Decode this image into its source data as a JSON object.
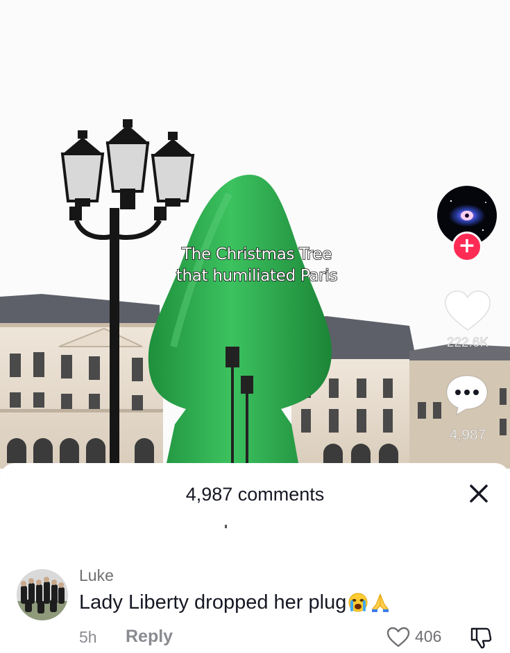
{
  "video": {
    "caption_line1": "The Christmas Tree",
    "caption_line2": "that humiliated Paris",
    "avatar_icon": "nebula-eye-avatar",
    "follow_icon": "plus-icon",
    "follow_symbol": "+",
    "likes": "222.6K",
    "comments": "4,987"
  },
  "comments_sheet": {
    "title": "4,987 comments",
    "close_icon": "close-icon",
    "comment": {
      "username": "Luke",
      "text": "Lady Liberty dropped her plug",
      "emojis": [
        "crying-face-emoji",
        "folded-hands-emoji"
      ],
      "time": "5h",
      "reply_label": "Reply",
      "like_count": "406"
    }
  },
  "colors": {
    "accent": "#fe2c55",
    "text_primary": "#161823",
    "text_secondary": "#8a8b91",
    "sculpture_green": "#2fae4f"
  }
}
